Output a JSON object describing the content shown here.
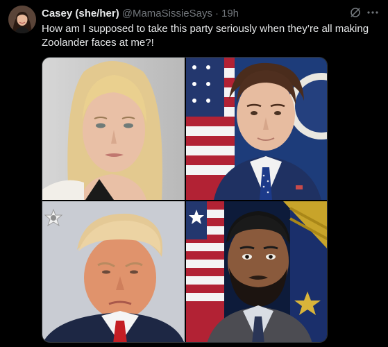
{
  "tweet": {
    "display_name": "Casey (she/her)",
    "handle": "@MamaSissieSays",
    "separator": "·",
    "time": "19h",
    "text": "How am I supposed to take this party seriously when they’re all making Zoolander faces at me?!"
  },
  "icons": {
    "avatar": "avatar",
    "grok": "grok-icon",
    "more": "more-icon"
  },
  "media": {
    "photos": [
      {
        "name": "photo-top-left"
      },
      {
        "name": "photo-top-right"
      },
      {
        "name": "photo-bottom-left"
      },
      {
        "name": "photo-bottom-right"
      }
    ]
  },
  "colors": {
    "background": "#000000",
    "text_primary": "#e7e9ea",
    "text_secondary": "#71767b",
    "border": "#2f3336"
  }
}
